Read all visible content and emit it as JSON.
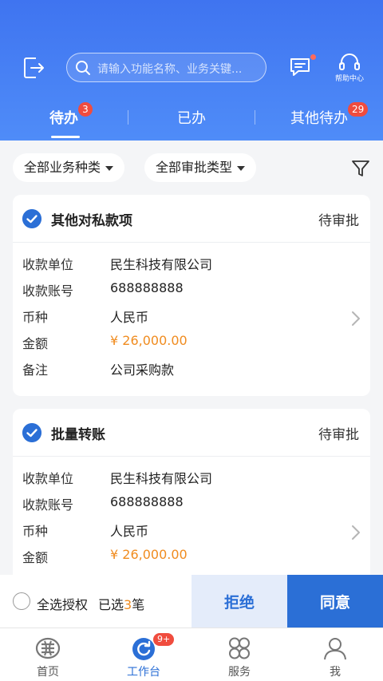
{
  "header": {
    "search_placeholder": "请输入功能名称、业务关键...",
    "help_label": "帮助中心"
  },
  "tabs": [
    {
      "label": "待办",
      "badge": "3"
    },
    {
      "label": "已办",
      "badge": ""
    },
    {
      "label": "其他待办",
      "badge": "29"
    }
  ],
  "filters": {
    "business_type": "全部业务种类",
    "approval_type": "全部审批类型"
  },
  "cards": [
    {
      "title": "其他对私款项",
      "status": "待审批",
      "rows": [
        {
          "key": "收款单位",
          "value": "民生科技有限公司"
        },
        {
          "key": "收款账号",
          "value": "688888888"
        },
        {
          "key": "币种",
          "value": "人民币"
        },
        {
          "key": "金额",
          "value": "¥ 26,000.00"
        },
        {
          "key": "备注",
          "value": "公司采购款"
        }
      ]
    },
    {
      "title": "批量转账",
      "status": "待审批",
      "rows": [
        {
          "key": "收款单位",
          "value": "民生科技有限公司"
        },
        {
          "key": "收款账号",
          "value": "688888888"
        },
        {
          "key": "币种",
          "value": "人民币"
        },
        {
          "key": "金额",
          "value": "¥ 26,000.00"
        }
      ]
    }
  ],
  "bottom_bar": {
    "select_all": "全选授权",
    "selected_prefix": "已选",
    "selected_count": "3",
    "selected_suffix": "笔",
    "reject": "拒绝",
    "agree": "同意"
  },
  "tabbar": [
    {
      "label": "首页",
      "badge": ""
    },
    {
      "label": "工作台",
      "badge": "9+"
    },
    {
      "label": "服务",
      "badge": ""
    },
    {
      "label": "我",
      "badge": ""
    }
  ],
  "colors": {
    "primary": "#2b6fd6",
    "amount": "#f08c20",
    "badge": "#f04c3e"
  }
}
